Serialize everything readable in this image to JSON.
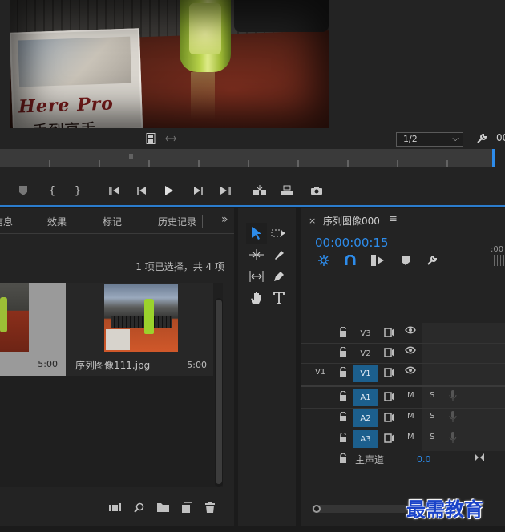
{
  "monitor": {
    "video_frame": {
      "book_title": "Here Pro",
      "book_subtitle": "手到高手"
    },
    "zoom_select": "1/2",
    "timecode_partial": "00"
  },
  "project_panel": {
    "tabs": [
      "信息",
      "效果",
      "标记",
      "历史记录"
    ],
    "more_icon": "double-chevron-right-icon",
    "selection_status": "1 项已选择，共 4 项",
    "clips": [
      {
        "name": "",
        "duration": "5:00"
      },
      {
        "name": "序列图像111.jpg",
        "duration": "5:00"
      }
    ]
  },
  "timeline": {
    "sequence_title": "序列图像000",
    "close_label": "×",
    "menu_label": "≡",
    "timecode": "00:00:00:15",
    "ruler_label": ":00",
    "video_tracks": [
      {
        "source": "",
        "name": "V3",
        "targeted": false
      },
      {
        "source": "",
        "name": "V2",
        "targeted": false
      },
      {
        "source": "V1",
        "name": "V1",
        "targeted": true
      }
    ],
    "audio_tracks": [
      {
        "name": "A1",
        "targeted": true,
        "mute": "M",
        "solo": "S"
      },
      {
        "name": "A2",
        "targeted": true,
        "mute": "M",
        "solo": "S"
      },
      {
        "name": "A3",
        "targeted": true,
        "mute": "M",
        "solo": "S"
      }
    ],
    "master": {
      "label": "主声道",
      "value": "0.0"
    }
  },
  "watermark": "最需教育",
  "colors": {
    "accent": "#2d8ceb",
    "track_target": "#1c5f8d",
    "watermark": "#1a43c8"
  }
}
